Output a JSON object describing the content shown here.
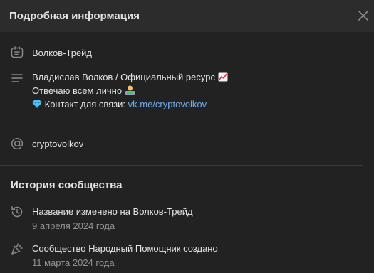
{
  "header": {
    "title": "Подробная информация"
  },
  "info": {
    "name": "Волков-Трейд",
    "description": {
      "line1": "Владислав Волков / Официальный ресурс",
      "line2": "Отвечаю всем лично",
      "line3_prefix": "Контакт для связи: ",
      "line3_link": "vk.me/cryptovolkov"
    },
    "handle": "cryptovolkov"
  },
  "history": {
    "title": "История сообщества",
    "events": [
      {
        "text": "Название изменено на Волков-Трейд",
        "date": "9 апреля 2024 года"
      },
      {
        "text": "Сообщество Народный Помощник создано",
        "date": "11 марта 2024 года"
      }
    ]
  },
  "icons": {
    "close": "close-icon",
    "name": "card-icon",
    "description": "text-lines-icon",
    "handle": "at-icon",
    "rename": "history-icon",
    "created": "party-popper-icon"
  }
}
